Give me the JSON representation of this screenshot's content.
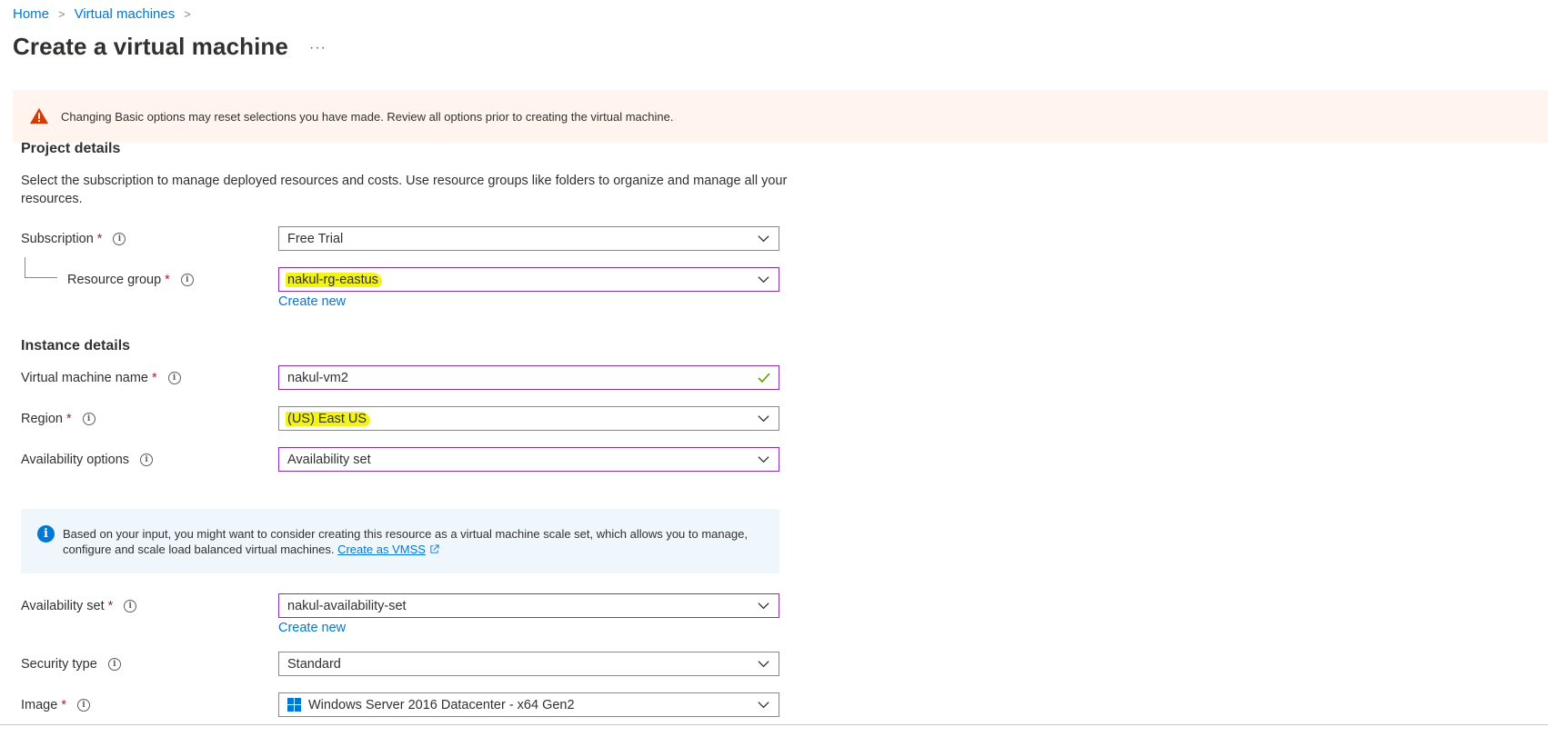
{
  "breadcrumb": {
    "home": "Home",
    "vms": "Virtual machines"
  },
  "page": {
    "title": "Create a virtual machine",
    "more": "···"
  },
  "warning": {
    "text": "Changing Basic options may reset selections you have made. Review all options prior to creating the virtual machine."
  },
  "project": {
    "title": "Project details",
    "description": "Select the subscription to manage deployed resources and costs. Use resource groups like folders to organize and manage all your resources.",
    "subscription_label": "Subscription",
    "subscription_value": "Free Trial",
    "resource_group_label": "Resource group",
    "resource_group_value": "nakul-rg-eastus",
    "create_new": "Create new"
  },
  "instance": {
    "title": "Instance details",
    "vm_name_label": "Virtual machine name",
    "vm_name_value": "nakul-vm2",
    "region_label": "Region",
    "region_value": "(US) East US",
    "availability_label": "Availability options",
    "availability_value": "Availability set",
    "info_text": "Based on your input, you might want to consider creating this resource as a virtual machine scale set, which allows you to manage, configure and scale load balanced virtual machines.",
    "info_link": "Create as VMSS",
    "availability_set_label": "Availability set",
    "availability_set_value": "nakul-availability-set",
    "create_new": "Create new",
    "security_label": "Security type",
    "security_value": "Standard",
    "image_label": "Image",
    "image_value": "Windows Server 2016 Datacenter - x64 Gen2"
  },
  "colors": {
    "accent": "#0078d4",
    "required": "#a4262c",
    "warning_bg": "#fff4ee",
    "info_bg": "#eff6fc",
    "field_active_border": "#8f2bbf",
    "highlight": "#f3f31c"
  },
  "icons": {
    "warning": "warning-triangle-icon",
    "info": "info-circle-icon",
    "dropdown": "chevron-down-icon",
    "valid": "checkmark-icon",
    "external": "external-link-icon",
    "windows": "windows-logo-icon"
  }
}
